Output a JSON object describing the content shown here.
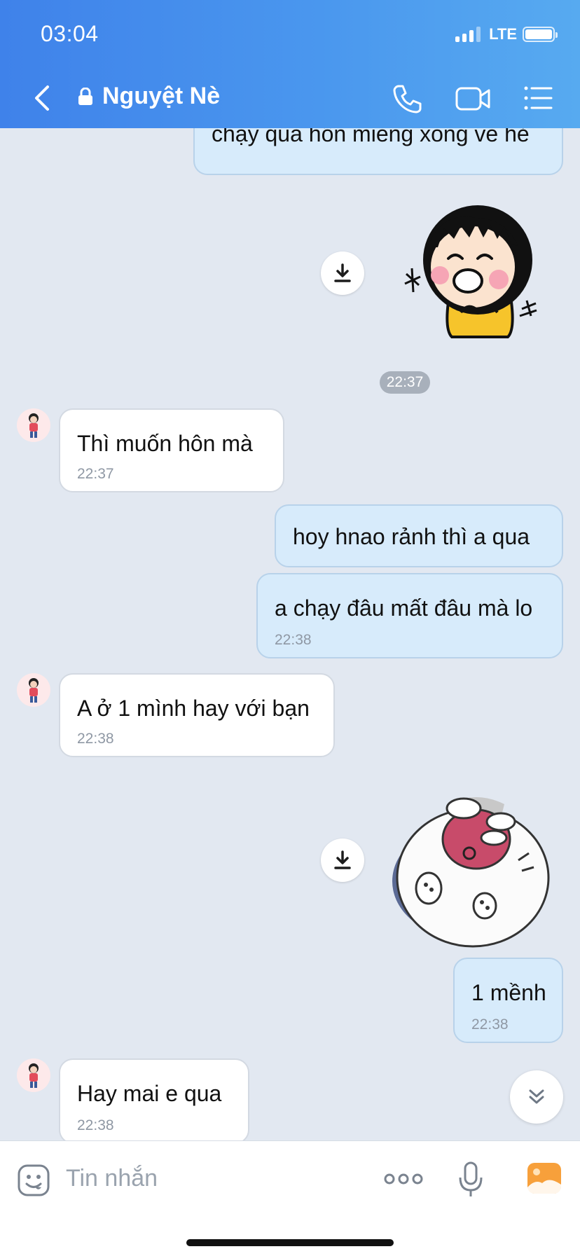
{
  "status_bar": {
    "time": "03:04",
    "network": "LTE"
  },
  "header": {
    "title": "Nguyệt Nè"
  },
  "messages": [
    {
      "dir": "out",
      "text": "chạy qua hôn miếng xong về hẻ"
    },
    {
      "type": "sticker",
      "dir": "out",
      "description": "girl-laughing-sticker"
    },
    {
      "type": "time_pill",
      "text": "22:37"
    },
    {
      "dir": "in",
      "text": "Thì muốn hôn mà",
      "time": "22:37"
    },
    {
      "dir": "out",
      "text": "hoy hnao rảnh thì a qua"
    },
    {
      "dir": "out",
      "text": "a chạy đâu mất đâu mà lo",
      "time": "22:38"
    },
    {
      "dir": "in",
      "text": "A ở 1 mình hay với bạn",
      "time": "22:38"
    },
    {
      "type": "sticker",
      "dir": "out",
      "description": "cat-laughing-sticker"
    },
    {
      "dir": "out",
      "text": "1 mềnh",
      "time": "22:38"
    },
    {
      "dir": "in",
      "text": "Hay mai e qua",
      "time": "22:38"
    }
  ],
  "composer": {
    "placeholder": "Tin nhắn"
  },
  "icons": {
    "back": "chevron-left-icon",
    "lock": "lock-icon",
    "call": "phone-icon",
    "video": "video-camera-icon",
    "menu": "list-icon",
    "emoji": "emoji-icon",
    "more": "more-dots-icon",
    "mic": "microphone-icon",
    "photo": "photo-icon",
    "download": "download-icon",
    "scroll_down": "chevrons-down-icon"
  },
  "colors": {
    "header_start": "#3f82ea",
    "header_end": "#57aaf0",
    "outgoing_bubble": "#d7ebfb",
    "incoming_bubble": "#ffffff",
    "background": "#e2e8f1",
    "photo_icon": "#f7a03b"
  }
}
